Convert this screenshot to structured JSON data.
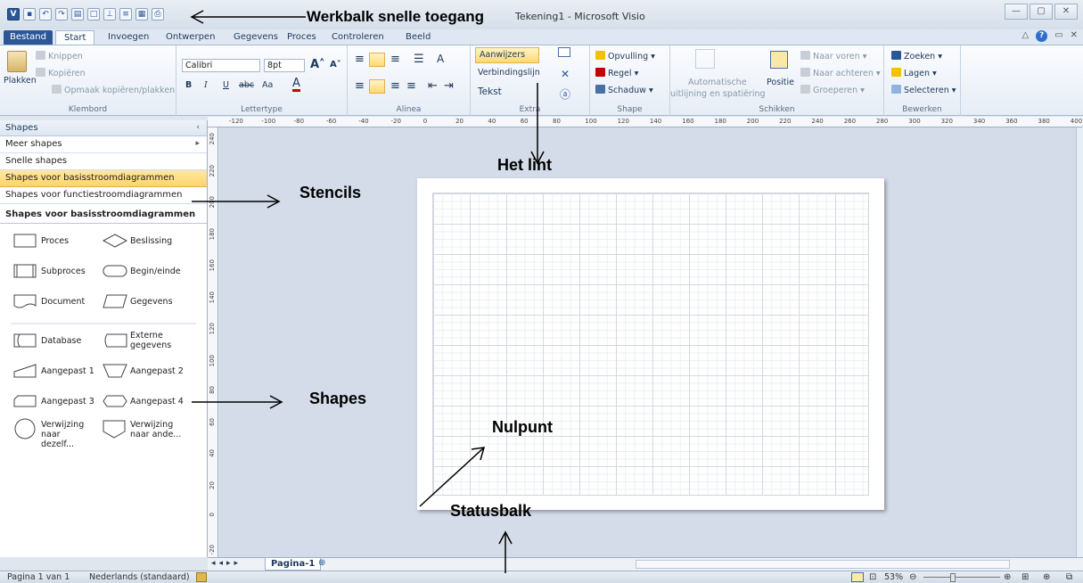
{
  "window": {
    "title": "Tekening1 - Microsoft Visio",
    "qat_icons": [
      "visio-icon",
      "save-icon",
      "undo-icon",
      "redo-icon",
      "open-icon",
      "new-icon",
      "connector-icon",
      "text-icon",
      "paste-icon",
      "print-icon"
    ],
    "controls": [
      "—",
      "▢",
      "✕"
    ]
  },
  "tabs": [
    "Bestand",
    "Start",
    "Invoegen",
    "Ontwerpen",
    "Gegevens",
    "Proces",
    "Controleren",
    "Beeld"
  ],
  "active_tab": "Start",
  "ribbon": {
    "clipboard": {
      "label": "Klembord",
      "paste": "Plakken",
      "cut": "Knippen",
      "copy": "Kopiëren",
      "format_painter": "Opmaak kopiëren/plakken"
    },
    "font": {
      "label": "Lettertype",
      "family": "Calibri",
      "size": "8pt",
      "bold": "B",
      "italic": "I",
      "underline": "U",
      "strike": "abc",
      "case": "Aa",
      "color": "A"
    },
    "paragraph": {
      "label": "Alinea"
    },
    "tools": {
      "label": "Extra",
      "pointer": "Aanwijzers",
      "connector": "Verbindingslijn",
      "text": "Tekst"
    },
    "shape": {
      "label": "Shape",
      "fill": "Opvulling",
      "line": "Regel",
      "shadow": "Schaduw"
    },
    "arrange": {
      "label": "Schikken",
      "auto_align_1": "Automatische",
      "auto_align_2": "uitlijning en spatiëring",
      "position": "Positie",
      "bring_forward": "Naar voren",
      "send_backward": "Naar achteren",
      "group": "Groeperen"
    },
    "editing": {
      "label": "Bewerken",
      "find": "Zoeken",
      "layers": "Lagen",
      "select": "Selecteren"
    }
  },
  "shapes_panel": {
    "title": "Shapes",
    "more": "Meer shapes",
    "quick": "Snelle shapes",
    "stencil_selected": "Shapes voor basisstroomdiagrammen",
    "stencil_other": "Shapes voor functiestroomdiagrammen",
    "section_header": "Shapes voor basisstroomdiagrammen",
    "items": [
      "Proces",
      "Beslissing",
      "Subproces",
      "Begin/einde",
      "Document",
      "Gegevens",
      "Database",
      "Externe gegevens",
      "Aangepast 1",
      "Aangepast 2",
      "Aangepast 3",
      "Aangepast 4",
      "Verwijzing naar dezelf...",
      "Verwijzing naar ande..."
    ]
  },
  "rulers": {
    "top": [
      "-120",
      "-100",
      "-80",
      "-60",
      "-40",
      "-20",
      "0",
      "20",
      "40",
      "60",
      "80",
      "100",
      "120",
      "140",
      "160",
      "180",
      "200",
      "220",
      "240",
      "260",
      "280",
      "300",
      "320",
      "340",
      "360",
      "380",
      "400"
    ],
    "left": [
      "240",
      "220",
      "200",
      "180",
      "160",
      "140",
      "120",
      "100",
      "80",
      "60",
      "40",
      "20",
      "0",
      "-20"
    ]
  },
  "page_tab": "Pagina-1",
  "status": {
    "page": "Pagina 1 van 1",
    "language": "Nederlands (standaard)",
    "zoom": "53%"
  },
  "annotations": {
    "qat": "Werkbalk snelle toegang",
    "ribbon": "Het lint",
    "stencils": "Stencils",
    "shapes": "Shapes",
    "origin": "Nulpunt",
    "statusbar": "Statusbalk"
  }
}
